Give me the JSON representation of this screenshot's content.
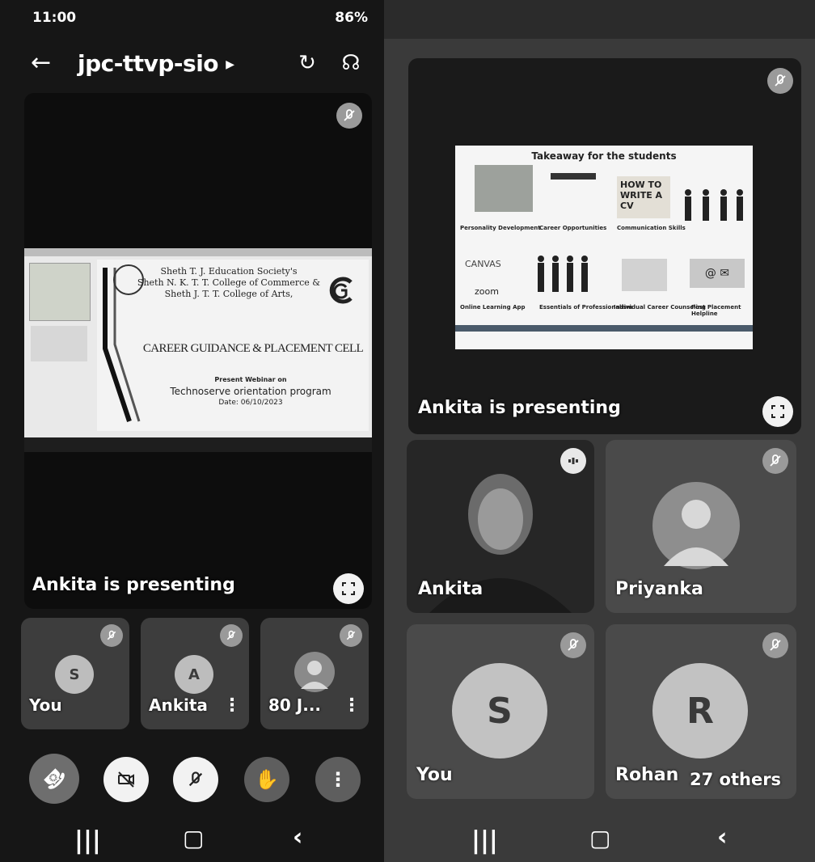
{
  "status": {
    "time": "11:00",
    "right": "86%"
  },
  "header": {
    "meeting_code": "jpc-ttvp-sio"
  },
  "left": {
    "presenting_label": "Ankita is presenting",
    "slide": {
      "line1": "Sheth T. J. Education Society's",
      "line2": "Sheth N. K. T. T. College of Commerce &",
      "line3": "Sheth J. T. T. College of Arts,",
      "heading": "CAREER GUIDANCE & PLACEMENT CELL",
      "present": "Present Webinar on",
      "title": "Technoserve orientation program",
      "date": "Date: 06/10/2023"
    },
    "tiles": [
      {
        "initial": "S",
        "name": "You"
      },
      {
        "initial": "A",
        "name": "Ankita"
      },
      {
        "initial": "",
        "name": "80 J..."
      }
    ]
  },
  "right": {
    "presenting_label": "Ankita is presenting",
    "slide": {
      "title": "Takeaway for the students",
      "howto": "HOW TO WRITE A CV",
      "canvas": "CANVAS",
      "zoom": "zoom",
      "c1": "Personality Development",
      "c2": "Career Opportunities",
      "c3": "Communication Skills",
      "c4": "Online Learning App",
      "c5": "Essentials of Professionalism",
      "c6": "Individual Career Counseling",
      "c7": "Post Placement Helpline"
    },
    "tiles": [
      {
        "name": "Ankita"
      },
      {
        "name": "Priyanka"
      },
      {
        "initial": "S",
        "name": "You"
      },
      {
        "initial": "R",
        "name": "Rohan",
        "others": "27 others"
      }
    ]
  },
  "colors": {
    "end_call": "#6e6e6e",
    "mute_badge": "#9a9a9a",
    "tile_bg": "#3c3c3c"
  }
}
